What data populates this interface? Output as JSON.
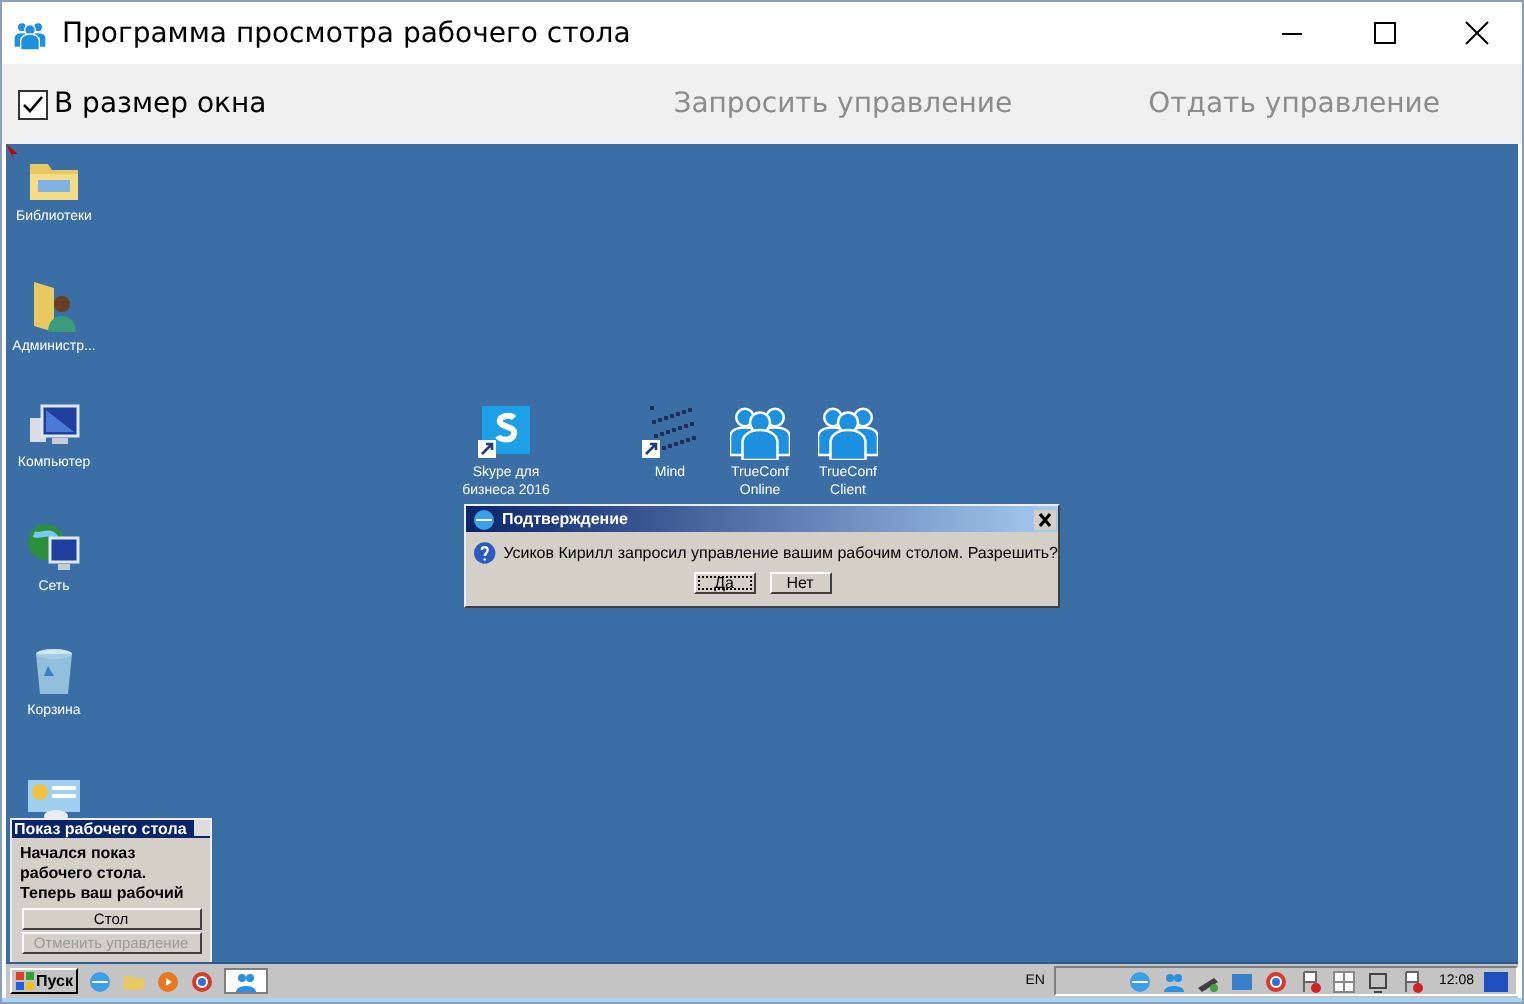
{
  "window": {
    "title": "Программа просмотра рабочего стола"
  },
  "toolbar": {
    "fit_checkbox": {
      "label": "В размер окна",
      "checked": true
    },
    "buttons": [
      {
        "label": "Запросить управление",
        "disabled": true
      },
      {
        "label": "Отдать управление",
        "disabled": true
      }
    ]
  },
  "desktop": {
    "left_icons": [
      {
        "label": "Библиотеки",
        "kind": "folder"
      },
      {
        "label": "Администр...",
        "kind": "user-folder"
      },
      {
        "label": "Компьютер",
        "kind": "computer"
      },
      {
        "label": "Сеть",
        "kind": "network"
      },
      {
        "label": "Корзина",
        "kind": "recycle-bin"
      },
      {
        "kind": "control-panel"
      }
    ],
    "center_icons": [
      {
        "label": "Skype для бизнеса 2016",
        "kind": "skype"
      },
      {
        "label": "Mind",
        "kind": "cube"
      },
      {
        "label": "TrueConf Online",
        "kind": "people"
      },
      {
        "label": "TrueConf Client",
        "kind": "people"
      }
    ],
    "share_popup": {
      "title": "Показ рабочего стола",
      "message": "Начался показ рабочего стола. Теперь ваш рабочий",
      "buttons": [
        {
          "label": "Стол",
          "disabled": false
        },
        {
          "label": "Отменить управление",
          "disabled": true
        }
      ]
    },
    "dialog": {
      "title": "Подтверждение",
      "message": "Усиков Кирилл запросил управление вашим рабочим столом. Разрешить?",
      "buttons": [
        {
          "label": "Да",
          "focused": true
        },
        {
          "label": "Нет",
          "focused": false
        }
      ]
    },
    "taskbar": {
      "start": "Пуск",
      "language": "EN",
      "clock": "12:08"
    }
  }
}
